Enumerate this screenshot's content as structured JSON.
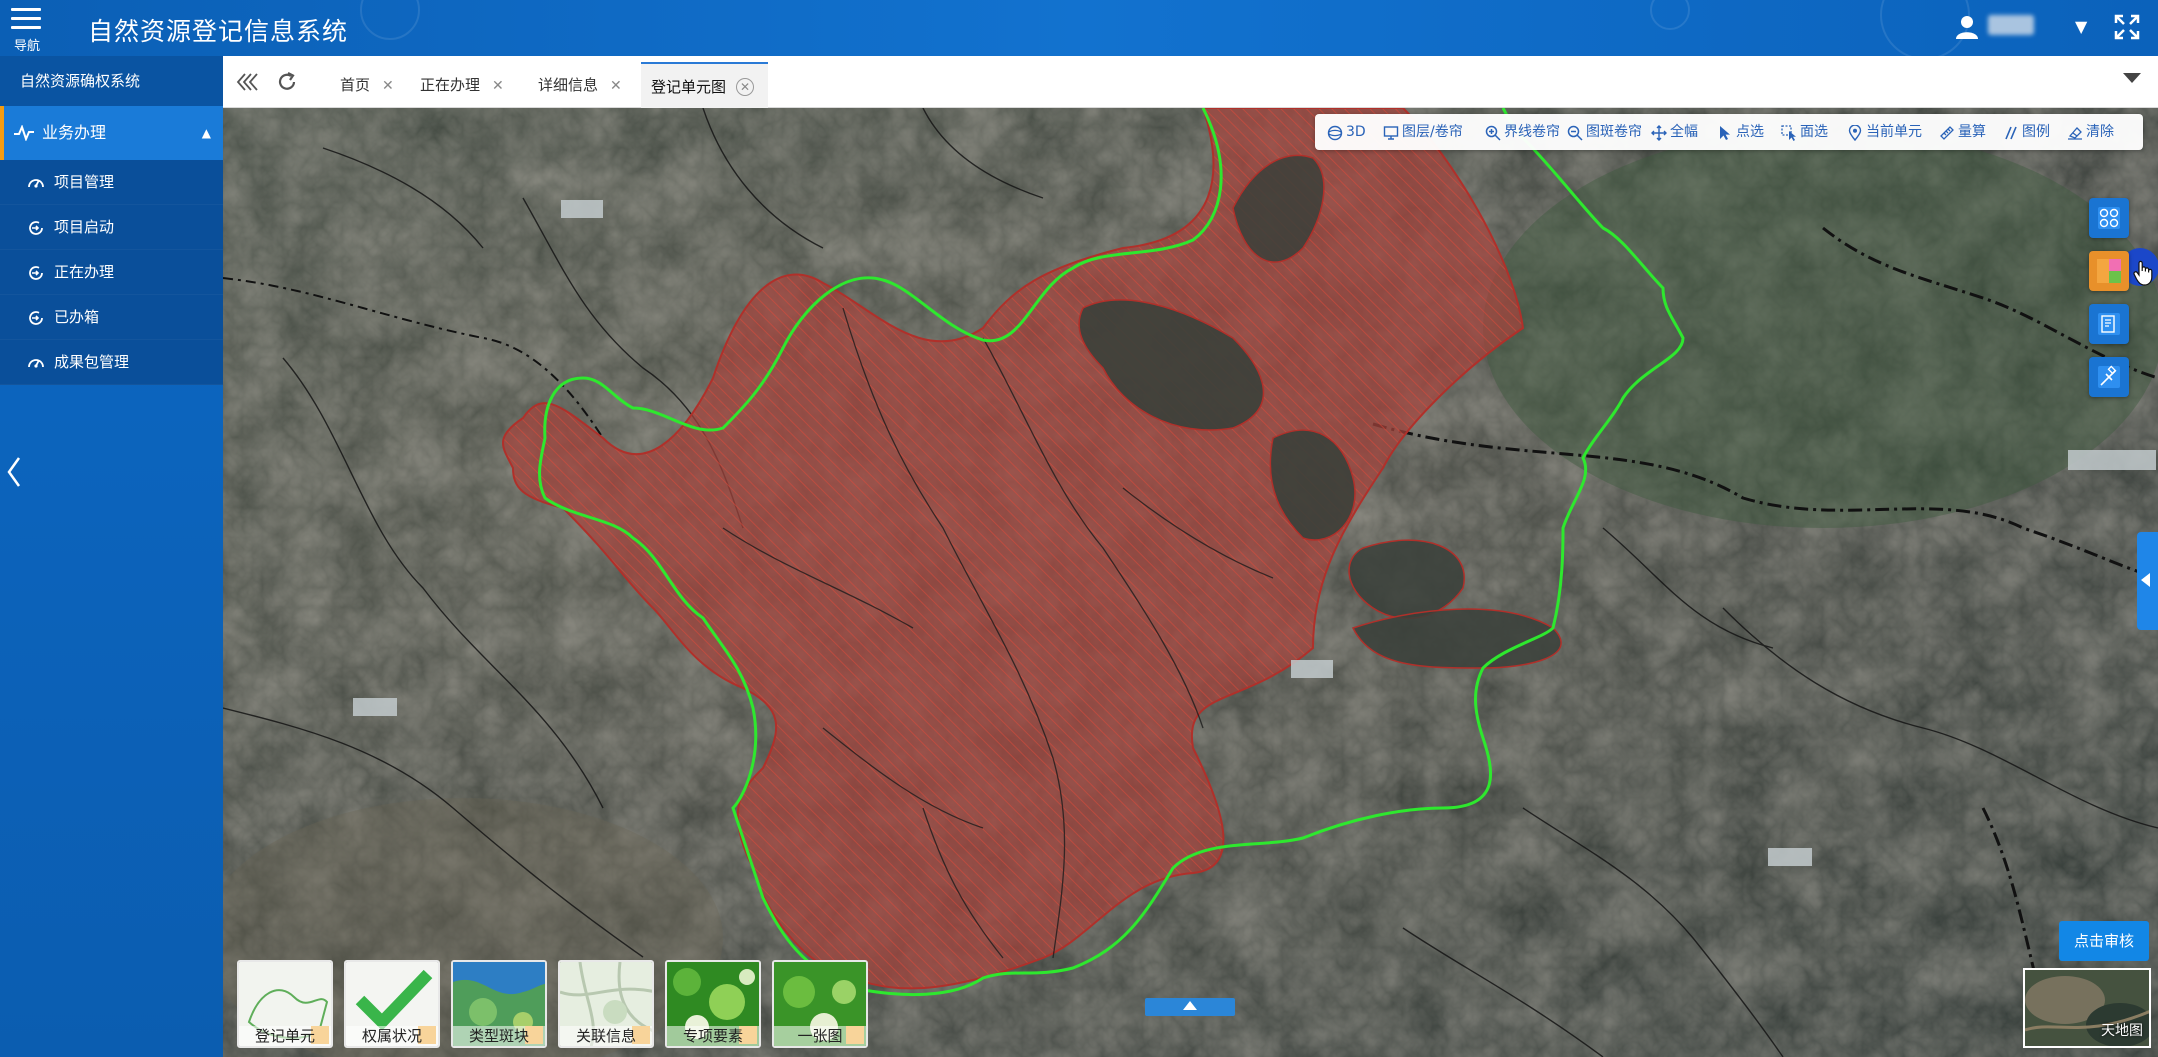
{
  "header": {
    "nav_label": "导航",
    "title": "自然资源登记信息系统"
  },
  "sidebar": {
    "system_title": "自然资源确权系统",
    "group_label": "业务办理",
    "items": [
      {
        "label": "项目管理",
        "icon": "dashboard-icon"
      },
      {
        "label": "项目启动",
        "icon": "circle-arrow-icon"
      },
      {
        "label": "正在办理",
        "icon": "circle-arrow-icon"
      },
      {
        "label": "已办箱",
        "icon": "circle-arrow-icon"
      },
      {
        "label": "成果包管理",
        "icon": "dashboard-icon"
      }
    ]
  },
  "tabs": [
    {
      "label": "首页",
      "active": false
    },
    {
      "label": "正在办理",
      "active": false
    },
    {
      "label": "详细信息",
      "active": false
    },
    {
      "label": "登记单元图",
      "active": true
    }
  ],
  "toolbar": [
    {
      "label": "3D",
      "icon": "globe-icon"
    },
    {
      "label": "图层/卷帘",
      "icon": "monitor-icon"
    },
    {
      "label": "界线卷帘",
      "icon": "zoom-in-icon"
    },
    {
      "label": "图斑卷帘",
      "icon": "zoom-out-icon"
    },
    {
      "label": "全幅",
      "icon": "move-icon"
    },
    {
      "label": "点选",
      "icon": "pointer-icon"
    },
    {
      "label": "面选",
      "icon": "select-area-icon"
    },
    {
      "label": "当前单元",
      "icon": "location-pin-icon"
    },
    {
      "label": "量算",
      "icon": "ruler-icon"
    },
    {
      "label": "图例",
      "icon": "legend-icon"
    },
    {
      "label": "清除",
      "icon": "eraser-icon"
    }
  ],
  "map": {
    "audit_button": "点击审核",
    "basemap_label": "天地图",
    "layers": [
      {
        "label": "登记单元"
      },
      {
        "label": "权属状况"
      },
      {
        "label": "类型斑块"
      },
      {
        "label": "关联信息"
      },
      {
        "label": "专项要素"
      },
      {
        "label": "一张图"
      }
    ]
  },
  "colors": {
    "header_blue": "#0b5fb5",
    "sidebar_blue": "#0b5db0",
    "accent_orange": "#f39c12",
    "parcel_fill": "#b8443a",
    "boundary_green": "#2ee82e"
  }
}
